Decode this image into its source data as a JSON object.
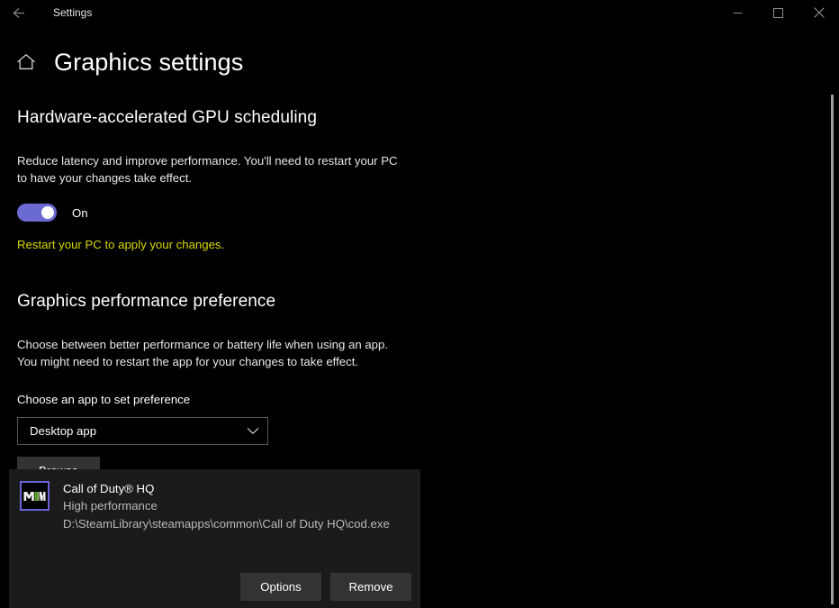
{
  "window": {
    "titlebar_title": "Settings",
    "back_icon": "arrow-left-icon",
    "minimize_icon": "minimize-icon",
    "maximize_icon": "maximize-icon",
    "close_icon": "close-icon"
  },
  "header": {
    "home_icon": "home-icon",
    "title": "Graphics settings"
  },
  "gpu_scheduling": {
    "heading": "Hardware-accelerated GPU scheduling",
    "description": "Reduce latency and improve performance. You'll need to restart your PC to have your changes take effect.",
    "toggle_state_label": "On",
    "toggle_on": true,
    "toggle_color": "#6a6ad2",
    "warning": "Restart your PC to apply your changes.",
    "warning_color": "#d8d800"
  },
  "performance_preference": {
    "heading": "Graphics performance preference",
    "description": "Choose between better performance or battery life when using an app. You might need to restart the app for your changes to take effect.",
    "field_label": "Choose an app to set preference",
    "dropdown": {
      "selected": "Desktop app",
      "chevron_icon": "chevron-down-icon"
    },
    "browse_label": "Browse"
  },
  "app_entry": {
    "icon_label": "MW",
    "icon_border_color": "#6a63d8",
    "name": "Call of Duty® HQ",
    "preference": "High performance",
    "path": "D:\\SteamLibrary\\steamapps\\common\\Call of Duty HQ\\cod.exe",
    "options_label": "Options",
    "remove_label": "Remove"
  },
  "scrollbar": {
    "present": true
  }
}
